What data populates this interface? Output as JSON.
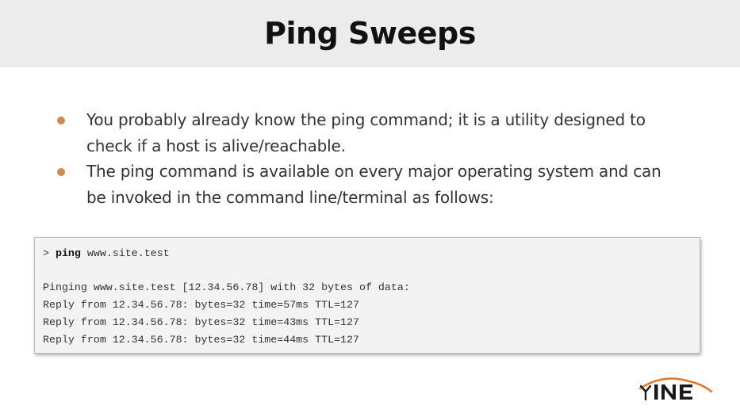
{
  "slide": {
    "title": "Ping Sweeps"
  },
  "bullets": [
    {
      "line1": "You probably already know the ping command; it is a utility designed to",
      "line2": "check if a host is alive/reachable."
    },
    {
      "line1": "The ping command is available on every major operating system and can",
      "line2": "be invoked in the command line/terminal as follows:"
    }
  ],
  "terminal": {
    "prompt": ">",
    "command": "ping",
    "argument": "www.site.test",
    "output": [
      "Pinging www.site.test [12.34.56.78] with 32 bytes of data:",
      "Reply from 12.34.56.78: bytes=32 time=57ms TTL=127",
      "Reply from 12.34.56.78: bytes=32 time=43ms TTL=127",
      "Reply from 12.34.56.78: bytes=32 time=44ms TTL=127"
    ]
  },
  "logo": {
    "text": "INE",
    "icon": "ine-logo-icon"
  },
  "colors": {
    "accent": "#c98a55",
    "title_bar": "#ececec",
    "logo_dark": "#1a1a1a",
    "logo_orange": "#e0762a"
  }
}
